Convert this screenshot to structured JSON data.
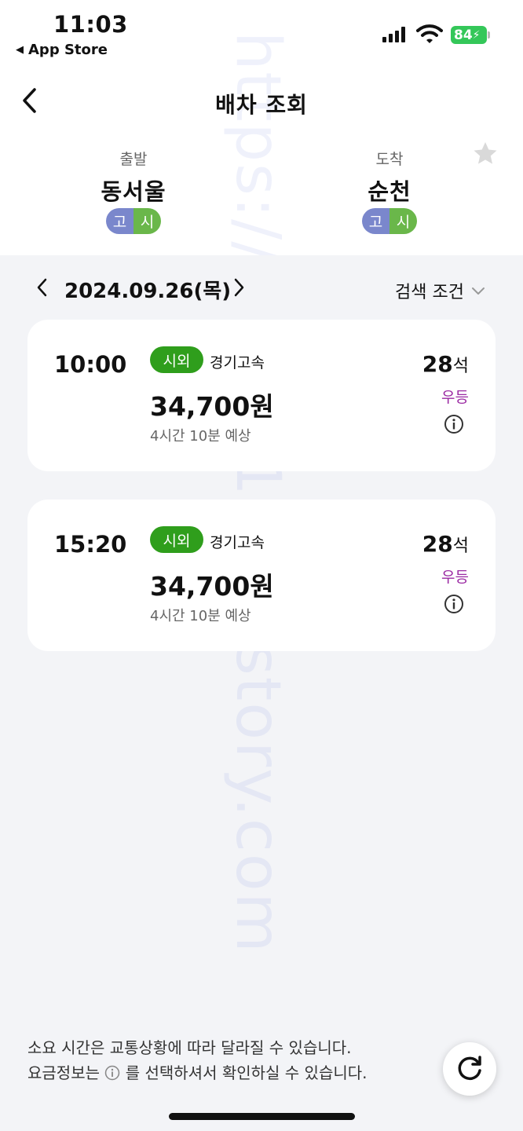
{
  "status_bar": {
    "time": "11:03",
    "back_app": "App Store",
    "battery": "84"
  },
  "header": {
    "title": "배차 조회"
  },
  "route": {
    "departure": {
      "label": "출발",
      "name": "동서울",
      "tag_a": "고",
      "tag_b": "시"
    },
    "arrival": {
      "label": "도착",
      "name": "순천",
      "tag_a": "고",
      "tag_b": "시"
    }
  },
  "date_bar": {
    "date": "2024.09.26(목)",
    "search_condition": "검색 조건"
  },
  "buses": [
    {
      "time": "10:00",
      "type": "시외",
      "company": "경기고속",
      "price": "34,700원",
      "duration": "4시간 10분 예상",
      "seats": "28",
      "seats_unit": "석",
      "grade": "우등"
    },
    {
      "time": "15:20",
      "type": "시외",
      "company": "경기고속",
      "price": "34,700원",
      "duration": "4시간 10분 예상",
      "seats": "28",
      "seats_unit": "석",
      "grade": "우등"
    }
  ],
  "footer": {
    "notice_line1": "소요 시간은 교통상황에 따라 달라질 수 있습니다.",
    "notice_line2_pre": "요금정보는",
    "notice_line2_post": "를 선택하셔서 확인하실 수 있습니다."
  },
  "watermark": "https://pepes119.tistory.com",
  "colors": {
    "accent_green": "#2f9e1c",
    "grade_purple": "#9b2aa3",
    "tag_blue": "#7a87cc",
    "tag_green": "#6ab74a",
    "battery_green": "#34c759"
  },
  "icons": [
    "back-arrow-icon",
    "star-icon",
    "chevron-left-icon",
    "chevron-right-icon",
    "chevron-down-icon",
    "info-icon",
    "refresh-icon",
    "signal-icon",
    "wifi-icon",
    "battery-icon"
  ]
}
